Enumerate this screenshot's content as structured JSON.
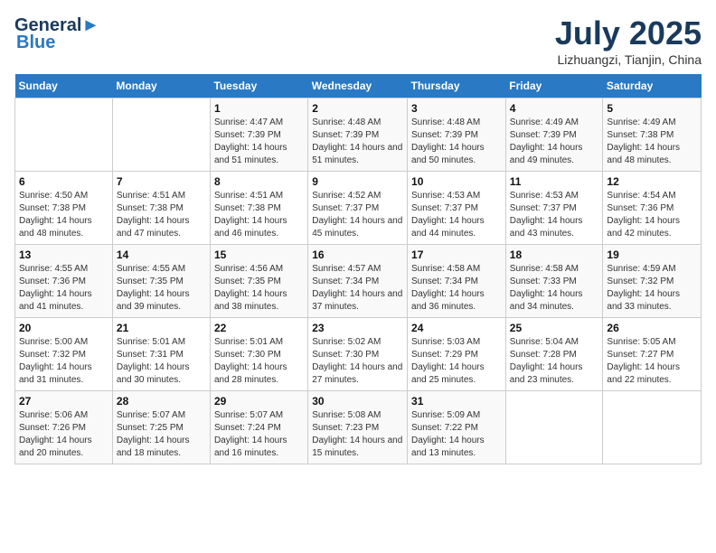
{
  "header": {
    "logo_line1": "General",
    "logo_line2": "Blue",
    "month": "July 2025",
    "location": "Lizhuangzi, Tianjin, China"
  },
  "days_of_week": [
    "Sunday",
    "Monday",
    "Tuesday",
    "Wednesday",
    "Thursday",
    "Friday",
    "Saturday"
  ],
  "weeks": [
    [
      {
        "day": "",
        "sunrise": "",
        "sunset": "",
        "daylight": ""
      },
      {
        "day": "",
        "sunrise": "",
        "sunset": "",
        "daylight": ""
      },
      {
        "day": "1",
        "sunrise": "Sunrise: 4:47 AM",
        "sunset": "Sunset: 7:39 PM",
        "daylight": "Daylight: 14 hours and 51 minutes."
      },
      {
        "day": "2",
        "sunrise": "Sunrise: 4:48 AM",
        "sunset": "Sunset: 7:39 PM",
        "daylight": "Daylight: 14 hours and 51 minutes."
      },
      {
        "day": "3",
        "sunrise": "Sunrise: 4:48 AM",
        "sunset": "Sunset: 7:39 PM",
        "daylight": "Daylight: 14 hours and 50 minutes."
      },
      {
        "day": "4",
        "sunrise": "Sunrise: 4:49 AM",
        "sunset": "Sunset: 7:39 PM",
        "daylight": "Daylight: 14 hours and 49 minutes."
      },
      {
        "day": "5",
        "sunrise": "Sunrise: 4:49 AM",
        "sunset": "Sunset: 7:38 PM",
        "daylight": "Daylight: 14 hours and 48 minutes."
      }
    ],
    [
      {
        "day": "6",
        "sunrise": "Sunrise: 4:50 AM",
        "sunset": "Sunset: 7:38 PM",
        "daylight": "Daylight: 14 hours and 48 minutes."
      },
      {
        "day": "7",
        "sunrise": "Sunrise: 4:51 AM",
        "sunset": "Sunset: 7:38 PM",
        "daylight": "Daylight: 14 hours and 47 minutes."
      },
      {
        "day": "8",
        "sunrise": "Sunrise: 4:51 AM",
        "sunset": "Sunset: 7:38 PM",
        "daylight": "Daylight: 14 hours and 46 minutes."
      },
      {
        "day": "9",
        "sunrise": "Sunrise: 4:52 AM",
        "sunset": "Sunset: 7:37 PM",
        "daylight": "Daylight: 14 hours and 45 minutes."
      },
      {
        "day": "10",
        "sunrise": "Sunrise: 4:53 AM",
        "sunset": "Sunset: 7:37 PM",
        "daylight": "Daylight: 14 hours and 44 minutes."
      },
      {
        "day": "11",
        "sunrise": "Sunrise: 4:53 AM",
        "sunset": "Sunset: 7:37 PM",
        "daylight": "Daylight: 14 hours and 43 minutes."
      },
      {
        "day": "12",
        "sunrise": "Sunrise: 4:54 AM",
        "sunset": "Sunset: 7:36 PM",
        "daylight": "Daylight: 14 hours and 42 minutes."
      }
    ],
    [
      {
        "day": "13",
        "sunrise": "Sunrise: 4:55 AM",
        "sunset": "Sunset: 7:36 PM",
        "daylight": "Daylight: 14 hours and 41 minutes."
      },
      {
        "day": "14",
        "sunrise": "Sunrise: 4:55 AM",
        "sunset": "Sunset: 7:35 PM",
        "daylight": "Daylight: 14 hours and 39 minutes."
      },
      {
        "day": "15",
        "sunrise": "Sunrise: 4:56 AM",
        "sunset": "Sunset: 7:35 PM",
        "daylight": "Daylight: 14 hours and 38 minutes."
      },
      {
        "day": "16",
        "sunrise": "Sunrise: 4:57 AM",
        "sunset": "Sunset: 7:34 PM",
        "daylight": "Daylight: 14 hours and 37 minutes."
      },
      {
        "day": "17",
        "sunrise": "Sunrise: 4:58 AM",
        "sunset": "Sunset: 7:34 PM",
        "daylight": "Daylight: 14 hours and 36 minutes."
      },
      {
        "day": "18",
        "sunrise": "Sunrise: 4:58 AM",
        "sunset": "Sunset: 7:33 PM",
        "daylight": "Daylight: 14 hours and 34 minutes."
      },
      {
        "day": "19",
        "sunrise": "Sunrise: 4:59 AM",
        "sunset": "Sunset: 7:32 PM",
        "daylight": "Daylight: 14 hours and 33 minutes."
      }
    ],
    [
      {
        "day": "20",
        "sunrise": "Sunrise: 5:00 AM",
        "sunset": "Sunset: 7:32 PM",
        "daylight": "Daylight: 14 hours and 31 minutes."
      },
      {
        "day": "21",
        "sunrise": "Sunrise: 5:01 AM",
        "sunset": "Sunset: 7:31 PM",
        "daylight": "Daylight: 14 hours and 30 minutes."
      },
      {
        "day": "22",
        "sunrise": "Sunrise: 5:01 AM",
        "sunset": "Sunset: 7:30 PM",
        "daylight": "Daylight: 14 hours and 28 minutes."
      },
      {
        "day": "23",
        "sunrise": "Sunrise: 5:02 AM",
        "sunset": "Sunset: 7:30 PM",
        "daylight": "Daylight: 14 hours and 27 minutes."
      },
      {
        "day": "24",
        "sunrise": "Sunrise: 5:03 AM",
        "sunset": "Sunset: 7:29 PM",
        "daylight": "Daylight: 14 hours and 25 minutes."
      },
      {
        "day": "25",
        "sunrise": "Sunrise: 5:04 AM",
        "sunset": "Sunset: 7:28 PM",
        "daylight": "Daylight: 14 hours and 23 minutes."
      },
      {
        "day": "26",
        "sunrise": "Sunrise: 5:05 AM",
        "sunset": "Sunset: 7:27 PM",
        "daylight": "Daylight: 14 hours and 22 minutes."
      }
    ],
    [
      {
        "day": "27",
        "sunrise": "Sunrise: 5:06 AM",
        "sunset": "Sunset: 7:26 PM",
        "daylight": "Daylight: 14 hours and 20 minutes."
      },
      {
        "day": "28",
        "sunrise": "Sunrise: 5:07 AM",
        "sunset": "Sunset: 7:25 PM",
        "daylight": "Daylight: 14 hours and 18 minutes."
      },
      {
        "day": "29",
        "sunrise": "Sunrise: 5:07 AM",
        "sunset": "Sunset: 7:24 PM",
        "daylight": "Daylight: 14 hours and 16 minutes."
      },
      {
        "day": "30",
        "sunrise": "Sunrise: 5:08 AM",
        "sunset": "Sunset: 7:23 PM",
        "daylight": "Daylight: 14 hours and 15 minutes."
      },
      {
        "day": "31",
        "sunrise": "Sunrise: 5:09 AM",
        "sunset": "Sunset: 7:22 PM",
        "daylight": "Daylight: 14 hours and 13 minutes."
      },
      {
        "day": "",
        "sunrise": "",
        "sunset": "",
        "daylight": ""
      },
      {
        "day": "",
        "sunrise": "",
        "sunset": "",
        "daylight": ""
      }
    ]
  ]
}
